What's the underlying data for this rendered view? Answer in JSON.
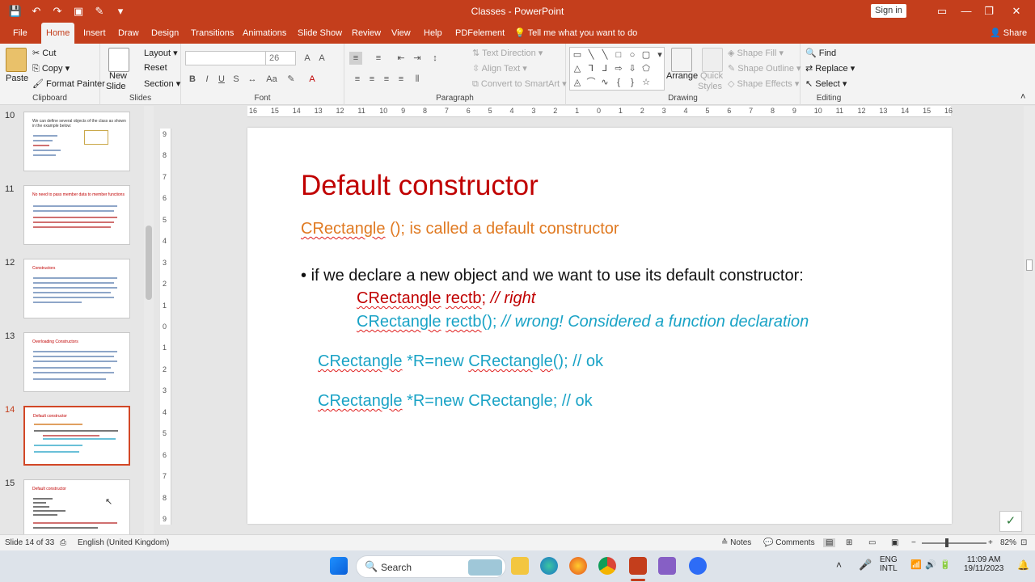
{
  "window": {
    "title": "Classes  -  PowerPoint",
    "signin": "Sign in",
    "min": "—",
    "restore": "❐",
    "close": "✕"
  },
  "tabs": [
    "File",
    "Home",
    "Insert",
    "Draw",
    "Design",
    "Transitions",
    "Animations",
    "Slide Show",
    "Review",
    "View",
    "Help",
    "PDFelement"
  ],
  "tellme": "Tell me what you want to do",
  "share": "Share",
  "ribbon": {
    "clipboard": {
      "label": "Clipboard",
      "paste": "Paste",
      "cut": "Cut",
      "copy": "Copy",
      "format_painter": "Format Painter"
    },
    "slides": {
      "label": "Slides",
      "new_slide": "New",
      "new_slide2": "Slide",
      "layout": "Layout",
      "reset": "Reset",
      "section": "Section"
    },
    "font": {
      "label": "Font",
      "font_name": "",
      "font_size": "26"
    },
    "paragraph": {
      "label": "Paragraph",
      "text_direction": "Text Direction",
      "align_text": "Align Text",
      "convert_smartart": "Convert to SmartArt"
    },
    "drawing": {
      "label": "Drawing",
      "arrange": "Arrange",
      "quick_styles": "Quick",
      "quick_styles2": "Styles",
      "shape_fill": "Shape Fill",
      "shape_outline": "Shape Outline",
      "shape_effects": "Shape Effects"
    },
    "editing": {
      "label": "Editing",
      "find": "Find",
      "replace": "Replace",
      "select": "Select"
    }
  },
  "thumbnails": [
    {
      "num": "10",
      "title": "We can define several objects of the class as shown in the example below:"
    },
    {
      "num": "11",
      "title": "No need to pass member data to member functions"
    },
    {
      "num": "12",
      "title": "Constructors"
    },
    {
      "num": "13",
      "title": "Overloading Constructors"
    },
    {
      "num": "14",
      "title": "Default constructor"
    },
    {
      "num": "15",
      "title": "Default constructor"
    }
  ],
  "ruler": {
    "h": [
      "16",
      "15",
      "14",
      "13",
      "12",
      "11",
      "10",
      "9",
      "8",
      "7",
      "6",
      "5",
      "4",
      "3",
      "2",
      "1",
      "0",
      "1",
      "2",
      "3",
      "4",
      "5",
      "6",
      "7",
      "8",
      "9",
      "10",
      "11",
      "12",
      "13",
      "14",
      "15",
      "16"
    ],
    "v": [
      "9",
      "8",
      "7",
      "6",
      "5",
      "4",
      "3",
      "2",
      "1",
      "0",
      "1",
      "2",
      "3",
      "4",
      "5",
      "6",
      "7",
      "8",
      "9"
    ]
  },
  "slide": {
    "title": "Default constructor",
    "sub_a": "CRectangle",
    "sub_b": " ();  is called a default constructor",
    "bullet_mark": "•",
    "bullet": "if we declare a new object and we want to use its default constructor:",
    "l1_a": "CRectangle",
    "l1_b": " ",
    "l1_c": "rectb",
    "l1_d": "; ",
    "l1_e": "// right",
    "l2_a": "CRectangle",
    "l2_b": " ",
    "l2_c": "rectb",
    "l2_d": "(); ",
    "l2_e": "// wrong!  Considered a function declaration",
    "l3_a": "CRectangle",
    "l3_b": " *R=new ",
    "l3_c": "CRectangle",
    "l3_d": "(); // ok",
    "l4_a": "CRectangle",
    "l4_b": " *R=new CRectangle; // ok"
  },
  "status": {
    "slide_of": "Slide 14 of 33",
    "language": "English (United Kingdom)",
    "notes": "Notes",
    "comments": "Comments",
    "zoom": "82%"
  },
  "taskbar": {
    "search": "Search",
    "lang1": "ENG",
    "lang2": "INTL",
    "time": "11:09 AM",
    "date": "19/11/2023"
  },
  "colors": {
    "accent": "#c43e1c",
    "title_red": "#c00000",
    "orange": "#e07a22",
    "teal": "#1aa3c6"
  }
}
